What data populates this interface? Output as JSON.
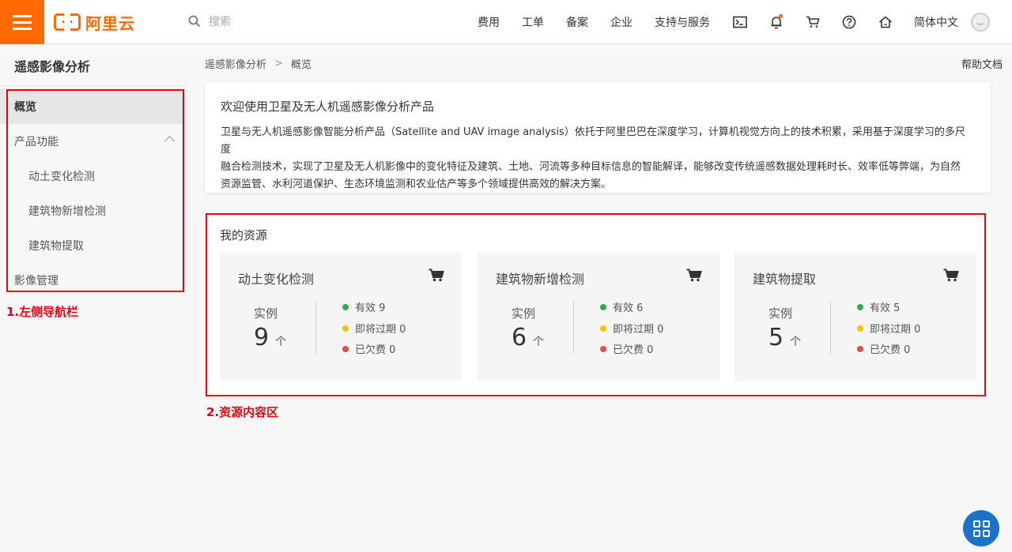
{
  "topbar": {
    "logo_text": "阿里云",
    "search_placeholder": "搜索",
    "nav": [
      "费用",
      "工单",
      "备案",
      "企业",
      "支持与服务"
    ],
    "language": "简体中文"
  },
  "sidebar": {
    "title": "遥感影像分析",
    "items": [
      {
        "label": "概览"
      },
      {
        "label": "产品功能"
      },
      {
        "label": "动土变化检测"
      },
      {
        "label": "建筑物新增检测"
      },
      {
        "label": "建筑物提取"
      },
      {
        "label": "影像管理"
      }
    ]
  },
  "annotations": {
    "nav_label": "1.左侧导航栏",
    "content_label": "2.资源内容区"
  },
  "breadcrumb": {
    "root": "遥感影像分析",
    "separator": ">",
    "current": "概览"
  },
  "help_link": "帮助文档",
  "welcome": {
    "title": "欢迎使用卫星及无人机遥感影像分析产品",
    "lines": [
      "卫星与无人机遥感影像智能分析产品（Satellite and UAV image analysis）依托于阿里巴巴在深度学习，计算机视觉方向上的技术积累，采用基于深度学习的多尺度",
      "融合检测技术，实现了卫星及无人机影像中的变化特征及建筑、土地、河流等多种目标信息的智能解译，能够改变传统遥感数据处理耗时长、效率低等弊端，为自然",
      "资源监管、水利河道保护、生态环境监测和农业估产等多个领域提供高效的解决方案。"
    ]
  },
  "resources": {
    "title": "我的资源",
    "instance_label": "实例",
    "unit": "个",
    "cards": [
      {
        "name": "动土变化检测",
        "count": "9",
        "valid": "有效 9",
        "expiring": "即将过期 0",
        "overdue": "已欠费 0"
      },
      {
        "name": "建筑物新增检测",
        "count": "6",
        "valid": "有效 6",
        "expiring": "即将过期 0",
        "overdue": "已欠费 0"
      },
      {
        "name": "建筑物提取",
        "count": "5",
        "valid": "有效 5",
        "expiring": "即将过期 0",
        "overdue": "已欠费 0"
      }
    ]
  },
  "colors": {
    "brand": "#ff6a00",
    "annotation_red": "#e60012",
    "status_valid": "#2bb24c",
    "status_expiring": "#f5c400",
    "status_overdue": "#e94b4b",
    "float_button": "#1a73c8"
  },
  "icons": [
    "menu-icon",
    "search-icon",
    "terminal-icon",
    "bell-icon",
    "cart-icon",
    "help-icon",
    "home-icon",
    "avatar",
    "chevron-up-icon",
    "chevron-left-icon",
    "grid-icon"
  ]
}
